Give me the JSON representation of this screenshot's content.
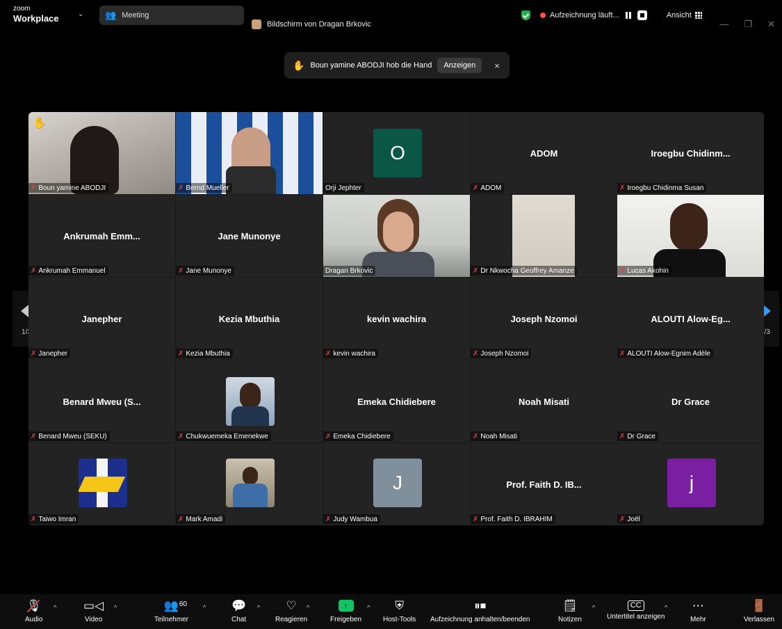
{
  "app": {
    "logo_top": "zoom",
    "logo_bottom": "Workplace",
    "meeting_label": "Meeting",
    "share_label": "Bildschirm von Dragan Brkovic",
    "recording_status": "Aufzeichnung läuft...",
    "view_label": "Ansicht"
  },
  "notification": {
    "text": "Boun yamine ABODJI hob die Hand",
    "button": "Anzeigen",
    "close": "×"
  },
  "pagination": {
    "left": "1/3",
    "right": "1/3"
  },
  "tiles": [
    {
      "label": "Boun yamine ABODJI",
      "display": ""
    },
    {
      "label": "Bernd Mueller",
      "display": ""
    },
    {
      "label": "Orji Jephter",
      "display": "",
      "initial": "O"
    },
    {
      "label": "ADOM",
      "display": "ADOM"
    },
    {
      "label": "Iroegbu Chidinma Susan",
      "display": "Iroegbu  Chidinm..."
    },
    {
      "label": "Ankrumah Emmanuel",
      "display": "Ankrumah  Emm..."
    },
    {
      "label": "Jane Munonye",
      "display": "Jane Munonye"
    },
    {
      "label": "Dragan Brkovic",
      "display": ""
    },
    {
      "label": "Dr Nkwocha Geoffrey Amanze",
      "display": ""
    },
    {
      "label": "Lucas Akohin",
      "display": ""
    },
    {
      "label": "Janepher",
      "display": "Janepher"
    },
    {
      "label": "Kezia Mbuthia",
      "display": "Kezia Mbuthia"
    },
    {
      "label": "kevin wachira",
      "display": "kevin wachira"
    },
    {
      "label": "Joseph Nzomoi",
      "display": "Joseph Nzomoi"
    },
    {
      "label": "ALOUTI Alow-Egnim Adèle",
      "display": "ALOUTI  Alow-Eg..."
    },
    {
      "label": "Benard Mweu (SEKU)",
      "display": "Benard Mweu (S..."
    },
    {
      "label": "Chukwuemeka Emenekwe",
      "display": ""
    },
    {
      "label": "Emeka Chidiebere",
      "display": "Emeka Chidiebere"
    },
    {
      "label": "Noah Misati",
      "display": "Noah Misati"
    },
    {
      "label": "Dr Grace",
      "display": "Dr Grace"
    },
    {
      "label": "Taiwo Imran",
      "display": ""
    },
    {
      "label": "Mark Amadi",
      "display": ""
    },
    {
      "label": "Judy Wambua",
      "display": "",
      "initial": "J"
    },
    {
      "label": "Prof. Faith  D. IBRAHIM",
      "display": "Prof. Faith  D. IB..."
    },
    {
      "label": "Joël",
      "display": "",
      "initial": "j"
    }
  ],
  "toolbar": {
    "audio": "Audio",
    "video": "Video",
    "participants": "Teilnehmer",
    "participants_count": "60",
    "chat": "Chat",
    "react": "Reagieren",
    "share": "Freigeben",
    "host_tools": "Host-Tools",
    "recording": "Aufzeichnung anhalten/beenden",
    "notes": "Notizen",
    "captions": "Untertitel anzeigen",
    "more": "Mehr",
    "leave": "Verlassen"
  },
  "colors": {
    "accent_green": "#14c266",
    "active_speaker": "#23d18b",
    "muted_red": "#e0413f",
    "avatar_orji": "#0a5745",
    "avatar_judy": "#7f8f9b",
    "avatar_joel": "#7b1fa2",
    "nav_arrow": "#2f9dfb"
  }
}
